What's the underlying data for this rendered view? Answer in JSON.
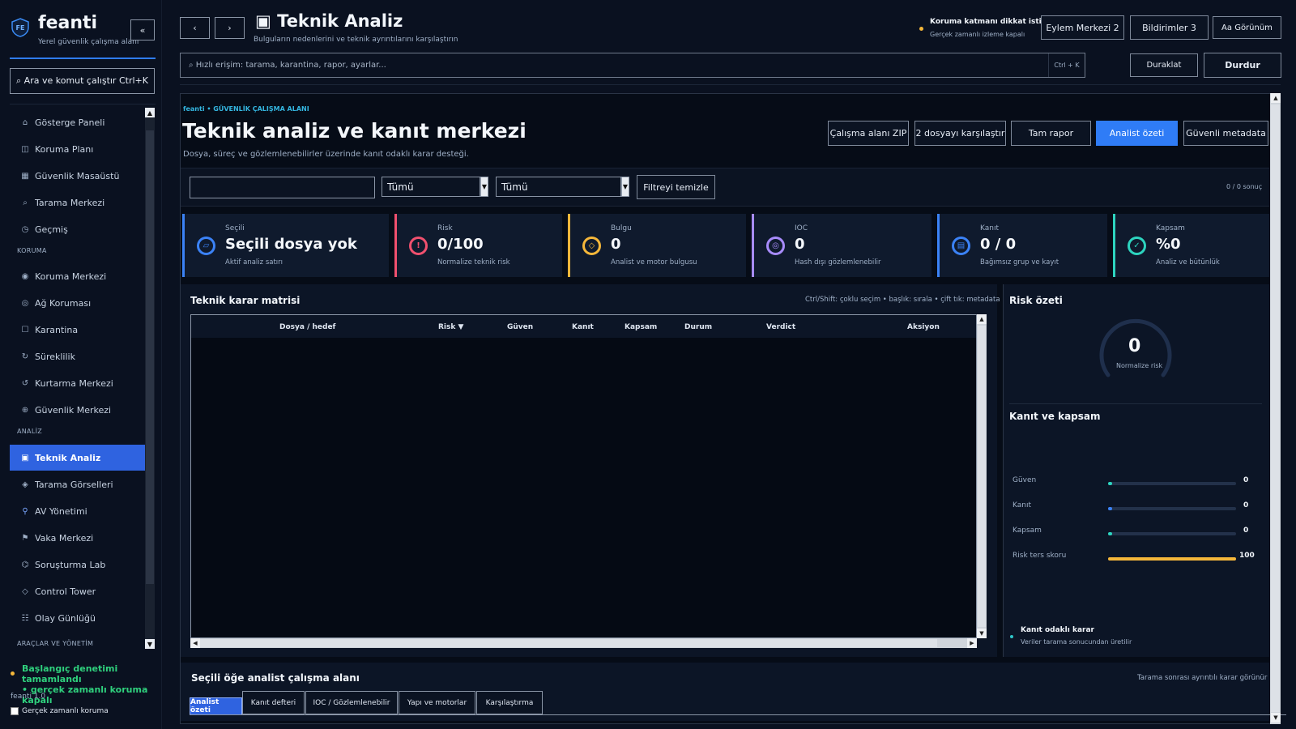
{
  "sidebar": {
    "brand": "feanti",
    "brand_sub": "Yerel güvenlik çalışma alanı",
    "logo_text": "FE",
    "collapse_label": "«",
    "search_label": "⌕ Ara ve komut çalıştır   Ctrl+K",
    "sections": {
      "koruma": "KORUMA",
      "analiz": "ANALİZ",
      "araclar": "ARAÇLAR VE YÖNETİM"
    },
    "items": [
      {
        "label": "Gösterge Paneli",
        "icon": "home-icon"
      },
      {
        "label": "Koruma Planı",
        "icon": "grid-icon"
      },
      {
        "label": "Güvenlik Masaüstü",
        "icon": "desktop-icon"
      },
      {
        "label": "Tarama Merkezi",
        "icon": "search-icon"
      },
      {
        "label": "Geçmiş",
        "icon": "clock-icon"
      },
      {
        "label": "Koruma Merkezi",
        "icon": "shield-icon"
      },
      {
        "label": "Ağ Koruması",
        "icon": "network-icon"
      },
      {
        "label": "Karantina",
        "icon": "box-icon"
      },
      {
        "label": "Süreklilik",
        "icon": "refresh-icon"
      },
      {
        "label": "Kurtarma Merkezi",
        "icon": "restore-icon"
      },
      {
        "label": "Güvenlik Merkezi",
        "icon": "target-icon"
      },
      {
        "label": "Teknik Analiz",
        "icon": "analysis-icon",
        "active": true
      },
      {
        "label": "Tarama Görselleri",
        "icon": "diamond-icon"
      },
      {
        "label": "AV Yönetimi",
        "icon": "dna-icon"
      },
      {
        "label": "Vaka Merkezi",
        "icon": "flag-icon"
      },
      {
        "label": "Soruşturma Lab",
        "icon": "lab-icon"
      },
      {
        "label": "Control Tower",
        "icon": "tower-icon"
      },
      {
        "label": "Olay Günlüğü",
        "icon": "list-icon"
      }
    ],
    "status_line1": "Başlangıç denetimi tamamlandı",
    "status_line2": "• gerçek zamanlı koruma kapalı",
    "version": "feanti 1.0",
    "realtime_label": "Gerçek zamanlı koruma"
  },
  "header": {
    "back": "‹",
    "forward": "›",
    "title": "▣ Teknik Analiz",
    "subtitle": "Bulguların nedenlerini ve teknik ayrıntılarını karşılaştırın",
    "alert_title": "Koruma katmanı dikkat istiyor",
    "alert_sub": "Gerçek zamanlı izleme kapalı",
    "action_center": "Eylem Merkezi  2",
    "notifications": "Bildirimler 3",
    "view": "Aa Görünüm",
    "quick_placeholder": "⌕ Hızlı erişim: tarama, karantina, rapor, ayarlar...",
    "quick_kbd": "Ctrl + K",
    "pause": "Duraklat",
    "stop": "Durdur"
  },
  "main": {
    "breadcrumb": "feanti • GÜVENLİK ÇALIŞMA ALANI",
    "title": "Teknik analiz ve kanıt merkezi",
    "subtitle": "Dosya, süreç ve gözlemlenebilirler üzerinde kanıt odaklı karar desteği.",
    "actions": {
      "zip": "Çalışma alanı ZIP",
      "compare": "2 dosyayı karşılaştır",
      "report": "Tam rapor",
      "summary": "Analist özeti",
      "metadata": "Güvenli metadata"
    },
    "filters": {
      "search_value": "",
      "select1": "Tümü",
      "select2": "Tümü",
      "clear": "Filtreyi temizle",
      "result_count": "0 / 0 sonuç"
    },
    "kpis": [
      {
        "label": "Seçili",
        "value": "Seçili dosya yok",
        "desc": "Aktif analiz satırı",
        "color": "#3b82f6",
        "icon": "▱",
        "icon_name": "selection-icon"
      },
      {
        "label": "Risk",
        "value": "0/100",
        "desc": "Normalize teknik risk",
        "color": "#f0506e",
        "icon": "!",
        "icon_name": "alert-icon"
      },
      {
        "label": "Bulgu",
        "value": "0",
        "desc": "Analist ve motor bulgusu",
        "color": "#f5b73a",
        "icon": "◇",
        "icon_name": "finding-icon"
      },
      {
        "label": "IOC",
        "value": "0",
        "desc": "Hash dışı gözlemlenebilir",
        "color": "#a78bfa",
        "icon": "◎",
        "icon_name": "ioc-icon"
      },
      {
        "label": "Kanıt",
        "value": "0 / 0",
        "desc": "Bağımsız grup ve kayıt",
        "color": "#3b82f6",
        "icon": "▤",
        "icon_name": "evidence-icon"
      },
      {
        "label": "Kapsam",
        "value": "%0",
        "desc": "Analiz ve bütünlük",
        "color": "#2dd4bf",
        "icon": "✓",
        "icon_name": "coverage-icon"
      }
    ],
    "matrix": {
      "title": "Teknik karar matrisi",
      "hint": "Ctrl/Shift: çoklu seçim • başlık: sırala • çift tık: metadata",
      "columns": [
        "Dosya / hedef",
        "Risk ▼",
        "Güven",
        "Kanıt",
        "Kapsam",
        "Durum",
        "Verdict",
        "Aksiyon"
      ],
      "rows": []
    },
    "risk": {
      "title": "Risk özeti",
      "score": "0",
      "score_label": "Normalize risk",
      "evidence_title": "Kanıt ve kapsam",
      "bars": [
        {
          "label": "Güven",
          "value": "0",
          "fraction": 0.02,
          "color": "#2dd4bf"
        },
        {
          "label": "Kanıt",
          "value": "0",
          "fraction": 0.02,
          "color": "#3b82f6"
        },
        {
          "label": "Kapsam",
          "value": "0",
          "fraction": 0.02,
          "color": "#2dd4bf"
        },
        {
          "label": "Risk ters skoru",
          "value": "100",
          "fraction": 1.0,
          "color": "#f5b73a"
        }
      ],
      "decision_title": "Kanıt odaklı karar",
      "decision_sub": "Veriler tarama sonucundan üretilir"
    },
    "analyst": {
      "title": "Seçili öğe analist çalışma alanı",
      "hint": "Tarama sonrası ayrıntılı karar görünür",
      "tabs": [
        "Analist özeti",
        "Kanıt defteri",
        "IOC / Gözlemlenebilir",
        "Yapı ve motorlar",
        "Karşılaştırma"
      ]
    }
  }
}
